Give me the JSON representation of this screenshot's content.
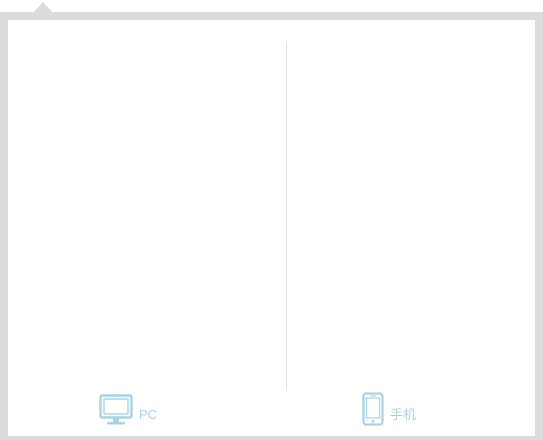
{
  "popover": {
    "devices": [
      {
        "label": "PC",
        "icon": "monitor-icon"
      },
      {
        "label": "手机",
        "icon": "phone-icon"
      }
    ]
  },
  "colors": {
    "frame": "#dcdcdc",
    "divider": "#e3e3e3",
    "accent": "#a7d3e0"
  }
}
